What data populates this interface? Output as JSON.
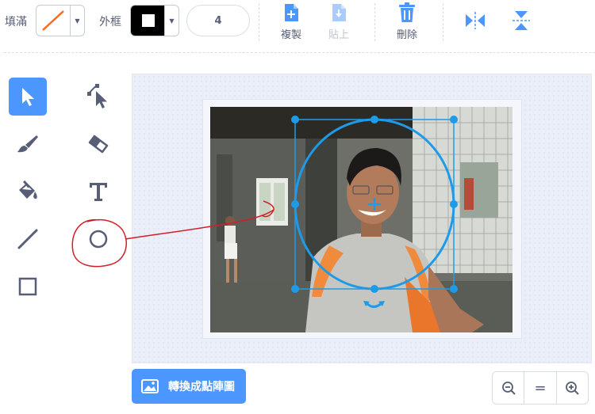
{
  "toolbar": {
    "fill_label": "填滿",
    "outline_label": "外框",
    "outline_width": "4",
    "fill_color": "#ff6a1a",
    "outline_color": "#000000",
    "copy_label": "複製",
    "paste_label": "貼上",
    "delete_label": "刪除",
    "icons": [
      "copy-icon",
      "paste-icon",
      "delete-icon",
      "flip-horizontal-icon",
      "flip-vertical-icon"
    ]
  },
  "tools": [
    "select-tool",
    "reshape-tool",
    "brush-tool",
    "eraser-tool",
    "fill-tool",
    "text-tool",
    "line-tool",
    "circle-tool",
    "rectangle-tool"
  ],
  "canvas": {
    "selection_color": "#1e9be8",
    "annotation_color": "#d0202a"
  },
  "bottom": {
    "convert_label": "轉換成點陣圖",
    "zoom_out_icon": "zoom-out-icon",
    "zoom_reset_label": "=",
    "zoom_in_icon": "zoom-in-icon"
  },
  "colors": {
    "accent": "#4c97ff",
    "text": "#575e75"
  }
}
